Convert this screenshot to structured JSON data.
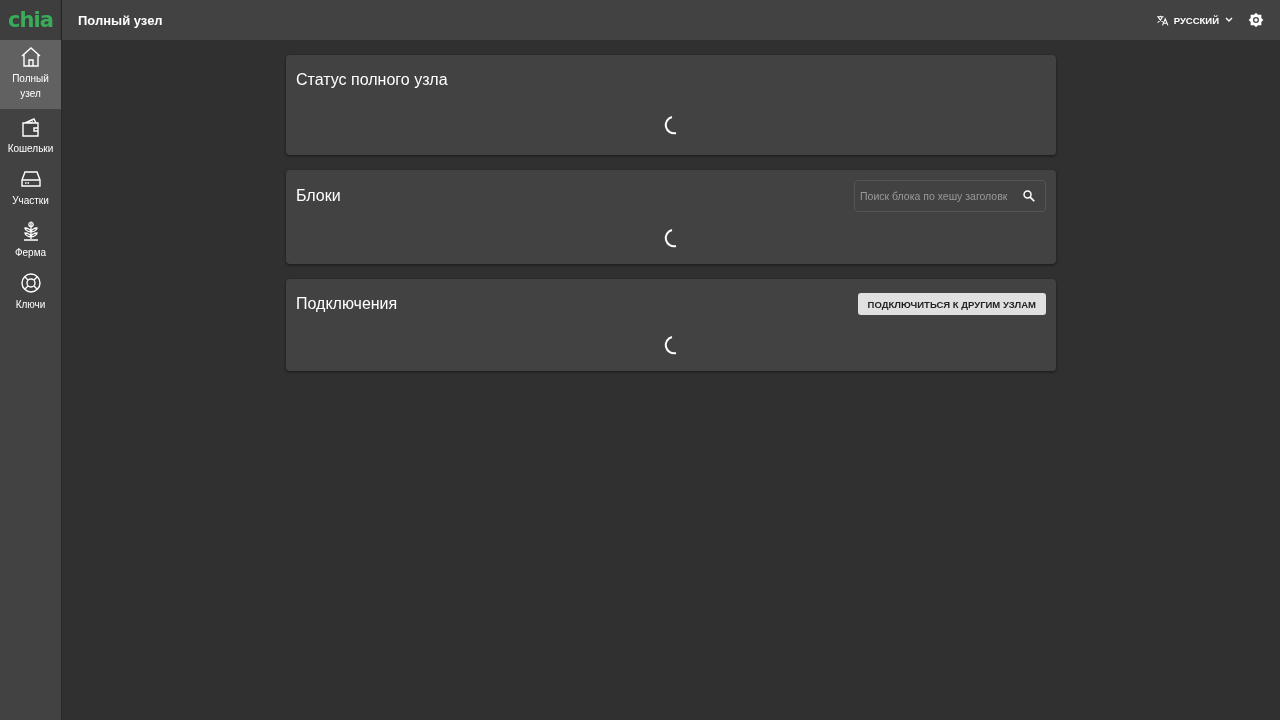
{
  "logo": "chia",
  "header": {
    "title": "Полный узел",
    "language": "РУССКИЙ"
  },
  "sidebar": {
    "items": [
      {
        "label": "Полный узел",
        "selected": true
      },
      {
        "label": "Кошельки",
        "selected": false
      },
      {
        "label": "Участки",
        "selected": false
      },
      {
        "label": "Ферма",
        "selected": false
      },
      {
        "label": "Ключи",
        "selected": false
      }
    ]
  },
  "cards": [
    {
      "title": "Статус полного узла",
      "kind": "plain",
      "loading": true
    },
    {
      "title": "Блоки",
      "kind": "search",
      "placeholder": "Поиск блока по хешу заголовк",
      "loading": true
    },
    {
      "title": "Подключения",
      "kind": "button",
      "button": "ПОДКЛЮЧИТЬСЯ К ДРУГИМ УЗЛАМ",
      "loading": true
    }
  ]
}
